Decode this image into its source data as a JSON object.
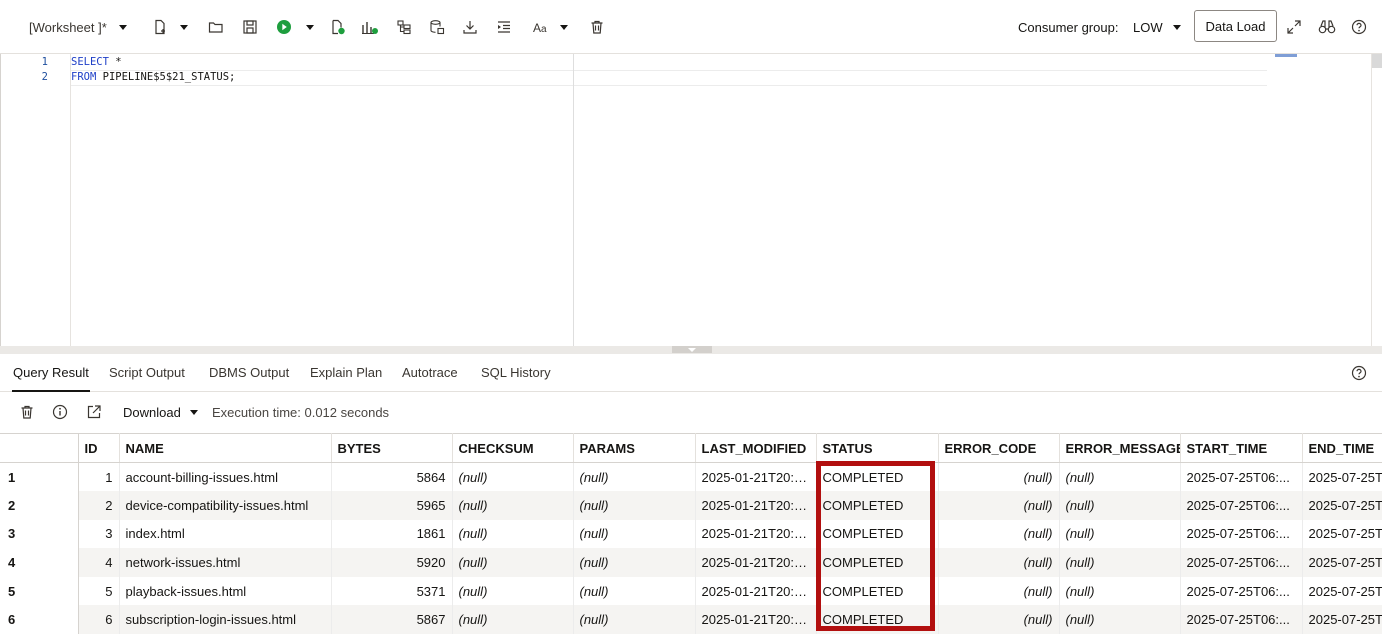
{
  "toolbar": {
    "worksheet_title": "[Worksheet ]*",
    "consumer_group_label": "Consumer group:",
    "consumer_group_value": "LOW",
    "data_load_label": "Data Load",
    "run_color": "#1e9e3e"
  },
  "editor": {
    "lines": [
      {
        "number": "1",
        "keyword": "SELECT",
        "rest": " *"
      },
      {
        "number": "2",
        "keyword": "FROM",
        "rest": " PIPELINE$5$21_STATUS;"
      }
    ]
  },
  "result_tabs": [
    "Query Result",
    "Script Output",
    "DBMS Output",
    "Explain Plan",
    "Autotrace",
    "SQL History"
  ],
  "result_toolbar": {
    "download_label": "Download",
    "execution_time": "Execution time: 0.012 seconds"
  },
  "grid": {
    "columns": [
      "ID",
      "NAME",
      "BYTES",
      "CHECKSUM",
      "PARAMS",
      "LAST_MODIFIED",
      "STATUS",
      "ERROR_CODE",
      "ERROR_MESSAGE",
      "START_TIME",
      "END_TIME"
    ],
    "rows": [
      {
        "row": "1",
        "id": "1",
        "name": "account-billing-issues.html",
        "bytes": "5864",
        "checksum": "(null)",
        "params": "(null)",
        "last_modified": "2025-01-21T20:1...",
        "status": "COMPLETED",
        "error_code": "(null)",
        "error_message": "(null)",
        "start_time": "2025-07-25T06:...",
        "end_time": "2025-07-25T"
      },
      {
        "row": "2",
        "id": "2",
        "name": "device-compatibility-issues.html",
        "bytes": "5965",
        "checksum": "(null)",
        "params": "(null)",
        "last_modified": "2025-01-21T20:1...",
        "status": "COMPLETED",
        "error_code": "(null)",
        "error_message": "(null)",
        "start_time": "2025-07-25T06:...",
        "end_time": "2025-07-25T"
      },
      {
        "row": "3",
        "id": "3",
        "name": "index.html",
        "bytes": "1861",
        "checksum": "(null)",
        "params": "(null)",
        "last_modified": "2025-01-21T20:1...",
        "status": "COMPLETED",
        "error_code": "(null)",
        "error_message": "(null)",
        "start_time": "2025-07-25T06:...",
        "end_time": "2025-07-25T"
      },
      {
        "row": "4",
        "id": "4",
        "name": "network-issues.html",
        "bytes": "5920",
        "checksum": "(null)",
        "params": "(null)",
        "last_modified": "2025-01-21T20:1...",
        "status": "COMPLETED",
        "error_code": "(null)",
        "error_message": "(null)",
        "start_time": "2025-07-25T06:...",
        "end_time": "2025-07-25T"
      },
      {
        "row": "5",
        "id": "5",
        "name": "playback-issues.html",
        "bytes": "5371",
        "checksum": "(null)",
        "params": "(null)",
        "last_modified": "2025-01-21T20:1...",
        "status": "COMPLETED",
        "error_code": "(null)",
        "error_message": "(null)",
        "start_time": "2025-07-25T06:...",
        "end_time": "2025-07-25T"
      },
      {
        "row": "6",
        "id": "6",
        "name": "subscription-login-issues.html",
        "bytes": "5867",
        "checksum": "(null)",
        "params": "(null)",
        "last_modified": "2025-01-21T20:1...",
        "status": "COMPLETED",
        "error_code": "(null)",
        "error_message": "(null)",
        "start_time": "2025-07-25T06:...",
        "end_time": "2025-07-25T"
      }
    ]
  },
  "highlight_color": "#b20f0f"
}
